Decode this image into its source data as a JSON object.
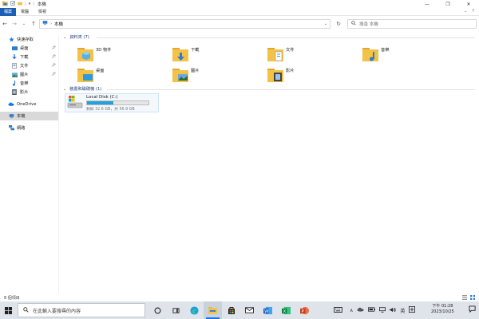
{
  "window": {
    "title": "本機",
    "colors": {
      "accent": "#1a5fb4",
      "folder": "#f3c247",
      "folder_dark": "#e0a82e",
      "drive_fill": "#26a0da"
    }
  },
  "ribbon": {
    "tabs": [
      "檔案",
      "電腦",
      "檢視"
    ],
    "active_tab": "檔案"
  },
  "address": {
    "crumb": "本機",
    "search_placeholder": "搜尋 本機"
  },
  "sidebar": {
    "quick_access": "快速存取",
    "items": [
      {
        "label": "桌面",
        "pinned": true,
        "icon": "desktop-icon"
      },
      {
        "label": "下載",
        "pinned": true,
        "icon": "download-icon"
      },
      {
        "label": "文件",
        "pinned": true,
        "icon": "document-icon"
      },
      {
        "label": "圖片",
        "pinned": true,
        "icon": "picture-icon"
      },
      {
        "label": "音樂",
        "pinned": false,
        "icon": "music-icon"
      },
      {
        "label": "影片",
        "pinned": false,
        "icon": "video-icon"
      }
    ],
    "onedrive": "OneDrive",
    "this_pc": "本機",
    "network": "網路"
  },
  "main": {
    "folders_header": "資料夾 (7)",
    "folders": [
      {
        "name": "3D 物件",
        "icon": "3d-objects-folder-icon"
      },
      {
        "name": "下載",
        "icon": "downloads-folder-icon"
      },
      {
        "name": "文件",
        "icon": "documents-folder-icon"
      },
      {
        "name": "音樂",
        "icon": "music-folder-icon"
      },
      {
        "name": "桌面",
        "icon": "desktop-folder-icon"
      },
      {
        "name": "圖片",
        "icon": "pictures-folder-icon"
      },
      {
        "name": "影片",
        "icon": "videos-folder-icon"
      }
    ],
    "drives_header": "裝置和磁碟機 (1)",
    "drive": {
      "name": "Local Disk (C:)",
      "free_text": "剩餘 32.6 GB，共 56.9 GB",
      "used_fraction": 0.43
    }
  },
  "status": {
    "item_count": "8 個項目"
  },
  "taskbar": {
    "search_placeholder": "在此輸入要搜尋的內容",
    "ime_mode": "英",
    "time": "下午 01:28",
    "date": "2023/10/25"
  }
}
